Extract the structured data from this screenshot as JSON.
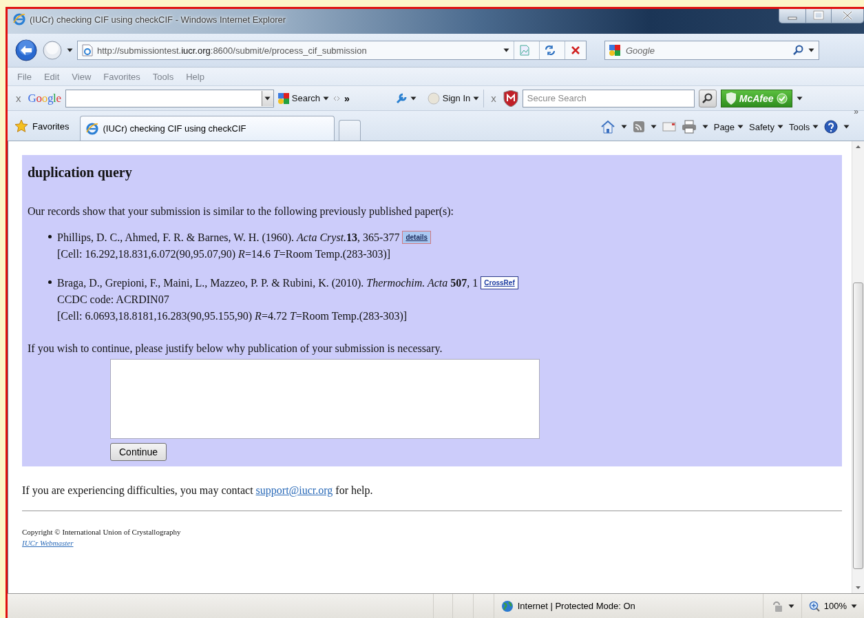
{
  "window": {
    "title": "(IUCr) checking CIF using checkCIF - Windows Internet Explorer"
  },
  "address_bar": {
    "url": "http://submissiontest.**iucr.org**:8600/submit/e/process_cif_submission"
  },
  "search_box": {
    "placeholder": "Google"
  },
  "menu": [
    "File",
    "Edit",
    "View",
    "Favorites",
    "Tools",
    "Help"
  ],
  "google_toolbar": {
    "close": "x",
    "brand": "Google",
    "search_button": "Search",
    "more": "»",
    "sign_in": "Sign In"
  },
  "mcafee_toolbar": {
    "close": "x",
    "search_placeholder": "Secure Search",
    "badge": "McAfee"
  },
  "favorites_bar": {
    "favorites": "Favorites",
    "tabs": [
      {
        "label": "(IUCr) checking CIF using checkCIF",
        "selected": true
      }
    ],
    "commands": [
      "Page",
      "Safety",
      "Tools"
    ],
    "more": "»"
  },
  "page": {
    "heading": "duplication query",
    "intro": "Our records show that your submission is similar to the following previously published paper(s):",
    "references": [
      {
        "authors": "Phillips, D. C., Ahmed, F. R. & Barnes, W. H. (1960).",
        "journal": "Acta Cryst.",
        "volume": "13",
        "pages": ", 365-377",
        "badge": {
          "kind": "details",
          "label": "details"
        },
        "lines": [
          "[Cell: 16.292,18.831,6.072(90,95.07,90) *R*=14.6 *T*=Room Temp.(283-303)]"
        ]
      },
      {
        "authors": "Braga, D., Grepioni, F., Maini, L., Mazzeo, P. P. & Rubini, K. (2010).",
        "journal": "Thermochim. Acta ",
        "volume": "507",
        "pages": ", 1",
        "badge": {
          "kind": "crossref",
          "label": "CrossRef"
        },
        "lines": [
          "CCDC code: ACRDIN07",
          "[Cell: 6.0693,18.8181,16.283(90,95.155,90) *R*=4.72 *T*=Room Temp.(283-303)]"
        ]
      }
    ],
    "prompt": "If you wish to continue, please justify below why publication of your submission is necessary.",
    "continue_button": "Continue",
    "help": {
      "before": "If you are experiencing difficulties, you may contact",
      "link": "support@iucr.org",
      "after": "for help."
    },
    "copyright": "Copyright © International Union of Crystallography",
    "webmaster_link": "IUCr Webmaster"
  },
  "status_bar": {
    "zone": "Internet | Protected Mode: On",
    "zoom": "100%"
  }
}
